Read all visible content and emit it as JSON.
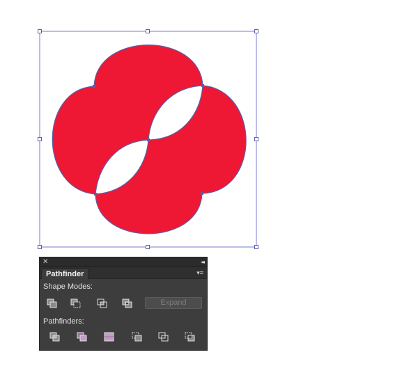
{
  "artwork": {
    "fill_color": "#ee1834",
    "path_color": "#5b5ea6",
    "bbox_color": "#7a7ad0"
  },
  "panel": {
    "close_glyph": "✕",
    "collapse_glyph": "◂◂",
    "tab_label": "Pathfinder",
    "menu_glyph": "▾≡",
    "shape_modes_label": "Shape Modes:",
    "pathfinders_label": "Pathfinders:",
    "expand_label": "Expand",
    "expand_enabled": false,
    "shape_mode_icons": [
      "unite-icon",
      "minus-front-icon",
      "intersect-icon",
      "exclude-icon"
    ],
    "pathfinder_icons": [
      "divide-icon",
      "trim-icon",
      "merge-icon",
      "crop-icon",
      "outline-icon",
      "minus-back-icon"
    ]
  }
}
